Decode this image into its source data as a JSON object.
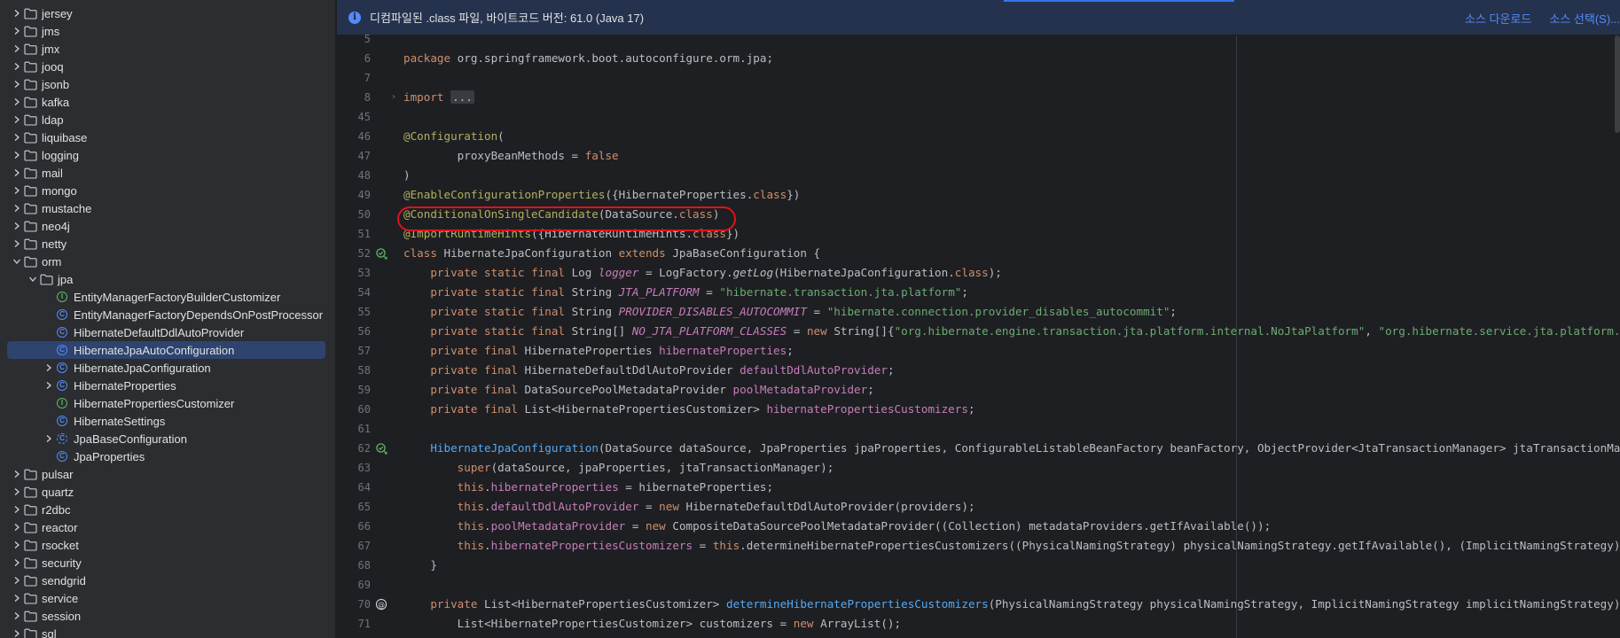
{
  "sidebar": {
    "items": [
      {
        "label": "jersey",
        "kind": "folder",
        "indent": 0,
        "expand": "collapsed",
        "icon": "folder-icon"
      },
      {
        "label": "jms",
        "kind": "folder",
        "indent": 0,
        "expand": "collapsed",
        "icon": "folder-icon"
      },
      {
        "label": "jmx",
        "kind": "folder",
        "indent": 0,
        "expand": "collapsed",
        "icon": "folder-icon"
      },
      {
        "label": "jooq",
        "kind": "folder",
        "indent": 0,
        "expand": "collapsed",
        "icon": "folder-icon"
      },
      {
        "label": "jsonb",
        "kind": "folder",
        "indent": 0,
        "expand": "collapsed",
        "icon": "folder-icon"
      },
      {
        "label": "kafka",
        "kind": "folder",
        "indent": 0,
        "expand": "collapsed",
        "icon": "folder-icon"
      },
      {
        "label": "ldap",
        "kind": "folder",
        "indent": 0,
        "expand": "collapsed",
        "icon": "folder-icon"
      },
      {
        "label": "liquibase",
        "kind": "folder",
        "indent": 0,
        "expand": "collapsed",
        "icon": "folder-icon"
      },
      {
        "label": "logging",
        "kind": "folder",
        "indent": 0,
        "expand": "collapsed",
        "icon": "folder-icon"
      },
      {
        "label": "mail",
        "kind": "folder",
        "indent": 0,
        "expand": "collapsed",
        "icon": "folder-icon"
      },
      {
        "label": "mongo",
        "kind": "folder",
        "indent": 0,
        "expand": "collapsed",
        "icon": "folder-icon"
      },
      {
        "label": "mustache",
        "kind": "folder",
        "indent": 0,
        "expand": "collapsed",
        "icon": "folder-icon"
      },
      {
        "label": "neo4j",
        "kind": "folder",
        "indent": 0,
        "expand": "collapsed",
        "icon": "folder-icon"
      },
      {
        "label": "netty",
        "kind": "folder",
        "indent": 0,
        "expand": "collapsed",
        "icon": "folder-icon"
      },
      {
        "label": "orm",
        "kind": "folder",
        "indent": 0,
        "expand": "expanded",
        "icon": "folder-icon"
      },
      {
        "label": "jpa",
        "kind": "folder",
        "indent": 1,
        "expand": "expanded",
        "icon": "folder-icon"
      },
      {
        "label": "EntityManagerFactoryBuilderCustomizer",
        "kind": "interface",
        "indent": 2,
        "expand": "none",
        "icon": "interface-icon"
      },
      {
        "label": "EntityManagerFactoryDependsOnPostProcessor",
        "kind": "class",
        "indent": 2,
        "expand": "none",
        "icon": "class-icon"
      },
      {
        "label": "HibernateDefaultDdlAutoProvider",
        "kind": "class",
        "indent": 2,
        "expand": "none",
        "icon": "class-icon"
      },
      {
        "label": "HibernateJpaAutoConfiguration",
        "kind": "class",
        "indent": 2,
        "expand": "none",
        "icon": "class-icon",
        "selected": true
      },
      {
        "label": "HibernateJpaConfiguration",
        "kind": "class",
        "indent": 2,
        "expand": "collapsed",
        "icon": "class-icon"
      },
      {
        "label": "HibernateProperties",
        "kind": "class",
        "indent": 2,
        "expand": "collapsed",
        "icon": "class-icon"
      },
      {
        "label": "HibernatePropertiesCustomizer",
        "kind": "interface",
        "indent": 2,
        "expand": "none",
        "icon": "interface-icon"
      },
      {
        "label": "HibernateSettings",
        "kind": "class",
        "indent": 2,
        "expand": "none",
        "icon": "class-icon"
      },
      {
        "label": "JpaBaseConfiguration",
        "kind": "abstract",
        "indent": 2,
        "expand": "collapsed",
        "icon": "abstract-class-icon"
      },
      {
        "label": "JpaProperties",
        "kind": "class",
        "indent": 2,
        "expand": "none",
        "icon": "class-icon"
      },
      {
        "label": "pulsar",
        "kind": "folder",
        "indent": 0,
        "expand": "collapsed",
        "icon": "folder-icon"
      },
      {
        "label": "quartz",
        "kind": "folder",
        "indent": 0,
        "expand": "collapsed",
        "icon": "folder-icon"
      },
      {
        "label": "r2dbc",
        "kind": "folder",
        "indent": 0,
        "expand": "collapsed",
        "icon": "folder-icon"
      },
      {
        "label": "reactor",
        "kind": "folder",
        "indent": 0,
        "expand": "collapsed",
        "icon": "folder-icon"
      },
      {
        "label": "rsocket",
        "kind": "folder",
        "indent": 0,
        "expand": "collapsed",
        "icon": "folder-icon"
      },
      {
        "label": "security",
        "kind": "folder",
        "indent": 0,
        "expand": "collapsed",
        "icon": "folder-icon"
      },
      {
        "label": "sendgrid",
        "kind": "folder",
        "indent": 0,
        "expand": "collapsed",
        "icon": "folder-icon"
      },
      {
        "label": "service",
        "kind": "folder",
        "indent": 0,
        "expand": "collapsed",
        "icon": "folder-icon"
      },
      {
        "label": "session",
        "kind": "folder",
        "indent": 0,
        "expand": "collapsed",
        "icon": "folder-icon"
      },
      {
        "label": "sql",
        "kind": "folder",
        "indent": 0,
        "expand": "collapsed",
        "icon": "folder-icon"
      }
    ]
  },
  "banner": {
    "message": "디컴파일된 .class 파일, 바이트코드 버전: 61.0 (Java 17)",
    "download_label": "소스 다운로드",
    "select_label": "소스 선택(S)..."
  },
  "colors": {
    "accent": "#3574f0",
    "annotation_circle": "#e0121b",
    "keyword": "#cf8e6d",
    "string": "#6aab73",
    "annotation": "#b3ae60",
    "field": "#c77dbb",
    "method": "#56a8f5"
  },
  "code": {
    "lines": [
      {
        "n": "5",
        "tokens": []
      },
      {
        "n": "6",
        "tokens": [
          [
            "kw",
            "package "
          ],
          [
            "",
            "org.springframework.boot.autoconfigure.orm.jpa;"
          ]
        ]
      },
      {
        "n": "7",
        "tokens": []
      },
      {
        "n": "8",
        "fold": true,
        "tokens": [
          [
            "kw",
            "import "
          ],
          [
            "fold",
            "..."
          ]
        ]
      },
      {
        "n": "45",
        "tokens": []
      },
      {
        "n": "46",
        "tokens": [
          [
            "ann",
            "@Configuration"
          ],
          [
            "",
            "("
          ]
        ]
      },
      {
        "n": "47",
        "tokens": [
          [
            "",
            "        proxyBeanMethods = "
          ],
          [
            "kw",
            "false"
          ]
        ]
      },
      {
        "n": "48",
        "tokens": [
          [
            "",
            ")"
          ]
        ]
      },
      {
        "n": "49",
        "tokens": [
          [
            "ann",
            "@EnableConfigurationProperties"
          ],
          [
            "",
            "({HibernateProperties."
          ],
          [
            "kw",
            "class"
          ],
          [
            "",
            "})"
          ]
        ]
      },
      {
        "n": "50",
        "tokens": [
          [
            "ann",
            "@ConditionalOnSingleCandidate"
          ],
          [
            "",
            "(DataSource."
          ],
          [
            "kw",
            "class"
          ],
          [
            "",
            ")"
          ]
        ]
      },
      {
        "n": "51",
        "tokens": [
          [
            "ann",
            "@ImportRuntimeHints"
          ],
          [
            "",
            "({HibernateRuntimeHints."
          ],
          [
            "kw",
            "class"
          ],
          [
            "",
            "})"
          ]
        ]
      },
      {
        "n": "52",
        "mark": "impl",
        "tokens": [
          [
            "kw",
            "class "
          ],
          [
            "",
            "HibernateJpaConfiguration "
          ],
          [
            "kw",
            "extends "
          ],
          [
            "",
            "JpaBaseConfiguration {"
          ]
        ]
      },
      {
        "n": "53",
        "tokens": [
          [
            "",
            "    "
          ],
          [
            "kw",
            "private static final "
          ],
          [
            "",
            "Log "
          ],
          [
            "ifld",
            "logger"
          ],
          [
            "",
            " = LogFactory."
          ],
          [
            "ital",
            "getLog"
          ],
          [
            "",
            "(HibernateJpaConfiguration."
          ],
          [
            "kw",
            "class"
          ],
          [
            "",
            ");"
          ]
        ]
      },
      {
        "n": "54",
        "tokens": [
          [
            "",
            "    "
          ],
          [
            "kw",
            "private static final "
          ],
          [
            "",
            "String "
          ],
          [
            "ifld",
            "JTA_PLATFORM"
          ],
          [
            "",
            " = "
          ],
          [
            "str",
            "\"hibernate.transaction.jta.platform\""
          ],
          [
            "",
            ";"
          ]
        ]
      },
      {
        "n": "55",
        "tokens": [
          [
            "",
            "    "
          ],
          [
            "kw",
            "private static final "
          ],
          [
            "",
            "String "
          ],
          [
            "ifld",
            "PROVIDER_DISABLES_AUTOCOMMIT"
          ],
          [
            "",
            " = "
          ],
          [
            "str",
            "\"hibernate.connection.provider_disables_autocommit\""
          ],
          [
            "",
            ";"
          ]
        ]
      },
      {
        "n": "56",
        "tokens": [
          [
            "",
            "    "
          ],
          [
            "kw",
            "private static final "
          ],
          [
            "",
            "String[] "
          ],
          [
            "ifld",
            "NO_JTA_PLATFORM_CLASSES"
          ],
          [
            "",
            " = "
          ],
          [
            "kw",
            "new "
          ],
          [
            "",
            "String[]{"
          ],
          [
            "str",
            "\"org.hibernate.engine.transaction.jta.platform.internal.NoJtaPlatform\""
          ],
          [
            "",
            ", "
          ],
          [
            "str",
            "\"org.hibernate.service.jta.platform.internal.NoJtaPlatform\""
          ],
          [
            "",
            "};"
          ]
        ]
      },
      {
        "n": "57",
        "tokens": [
          [
            "",
            "    "
          ],
          [
            "kw",
            "private final "
          ],
          [
            "",
            "HibernateProperties "
          ],
          [
            "fld",
            "hibernateProperties"
          ],
          [
            "",
            ";"
          ]
        ]
      },
      {
        "n": "58",
        "tokens": [
          [
            "",
            "    "
          ],
          [
            "kw",
            "private final "
          ],
          [
            "",
            "HibernateDefaultDdlAutoProvider "
          ],
          [
            "fld",
            "defaultDdlAutoProvider"
          ],
          [
            "",
            ";"
          ]
        ]
      },
      {
        "n": "59",
        "tokens": [
          [
            "",
            "    "
          ],
          [
            "kw",
            "private final "
          ],
          [
            "",
            "DataSourcePoolMetadataProvider "
          ],
          [
            "fld",
            "poolMetadataProvider"
          ],
          [
            "",
            ";"
          ]
        ]
      },
      {
        "n": "60",
        "tokens": [
          [
            "",
            "    "
          ],
          [
            "kw",
            "private final "
          ],
          [
            "",
            "List<HibernatePropertiesCustomizer> "
          ],
          [
            "fld",
            "hibernatePropertiesCustomizers"
          ],
          [
            "",
            ";"
          ]
        ]
      },
      {
        "n": "61",
        "tokens": []
      },
      {
        "n": "62",
        "mark": "impl",
        "tokens": [
          [
            "",
            "    "
          ],
          [
            "mth",
            "HibernateJpaConfiguration"
          ],
          [
            "",
            "(DataSource dataSource, JpaProperties jpaProperties, ConfigurableListableBeanFactory beanFactory, ObjectProvider<JtaTransactionManager> jtaTransactionManager, HibernateProperties hibernateProperties) {"
          ]
        ]
      },
      {
        "n": "63",
        "tokens": [
          [
            "",
            "        "
          ],
          [
            "kw",
            "super"
          ],
          [
            "",
            "(dataSource, jpaProperties, jtaTransactionManager);"
          ]
        ]
      },
      {
        "n": "64",
        "tokens": [
          [
            "",
            "        "
          ],
          [
            "kw",
            "this"
          ],
          [
            "",
            "."
          ],
          [
            "fld",
            "hibernateProperties"
          ],
          [
            "",
            " = hibernateProperties;"
          ]
        ]
      },
      {
        "n": "65",
        "tokens": [
          [
            "",
            "        "
          ],
          [
            "kw",
            "this"
          ],
          [
            "",
            "."
          ],
          [
            "fld",
            "defaultDdlAutoProvider"
          ],
          [
            "",
            " = "
          ],
          [
            "kw",
            "new "
          ],
          [
            "",
            "HibernateDefaultDdlAutoProvider(providers);"
          ]
        ]
      },
      {
        "n": "66",
        "tokens": [
          [
            "",
            "        "
          ],
          [
            "kw",
            "this"
          ],
          [
            "",
            "."
          ],
          [
            "fld",
            "poolMetadataProvider"
          ],
          [
            "",
            " = "
          ],
          [
            "kw",
            "new "
          ],
          [
            "",
            "CompositeDataSourcePoolMetadataProvider((Collection) metadataProviders.getIfAvailable());"
          ]
        ]
      },
      {
        "n": "67",
        "tokens": [
          [
            "",
            "        "
          ],
          [
            "kw",
            "this"
          ],
          [
            "",
            "."
          ],
          [
            "fld",
            "hibernatePropertiesCustomizers"
          ],
          [
            "",
            " = "
          ],
          [
            "kw",
            "this"
          ],
          [
            "",
            ".determineHibernatePropertiesCustomizers((PhysicalNamingStrategy) physicalNamingStrategy.getIfAvailable(), (ImplicitNamingStrategy) implicitNamingStrategy.getIfAvailable());"
          ]
        ]
      },
      {
        "n": "68",
        "tokens": [
          [
            "",
            "    }"
          ]
        ]
      },
      {
        "n": "69",
        "tokens": []
      },
      {
        "n": "70",
        "mark": "at",
        "tokens": [
          [
            "",
            "    "
          ],
          [
            "kw",
            "private "
          ],
          [
            "",
            "List<HibernatePropertiesCustomizer> "
          ],
          [
            "mth",
            "determineHibernatePropertiesCustomizers"
          ],
          [
            "",
            "(PhysicalNamingStrategy physicalNamingStrategy, ImplicitNamingStrategy implicitNamingStrategy) {"
          ]
        ]
      },
      {
        "n": "71",
        "tokens": [
          [
            "",
            "        List<HibernatePropertiesCustomizer> customizers = "
          ],
          [
            "kw",
            "new "
          ],
          [
            "",
            "ArrayList();"
          ]
        ]
      }
    ]
  }
}
